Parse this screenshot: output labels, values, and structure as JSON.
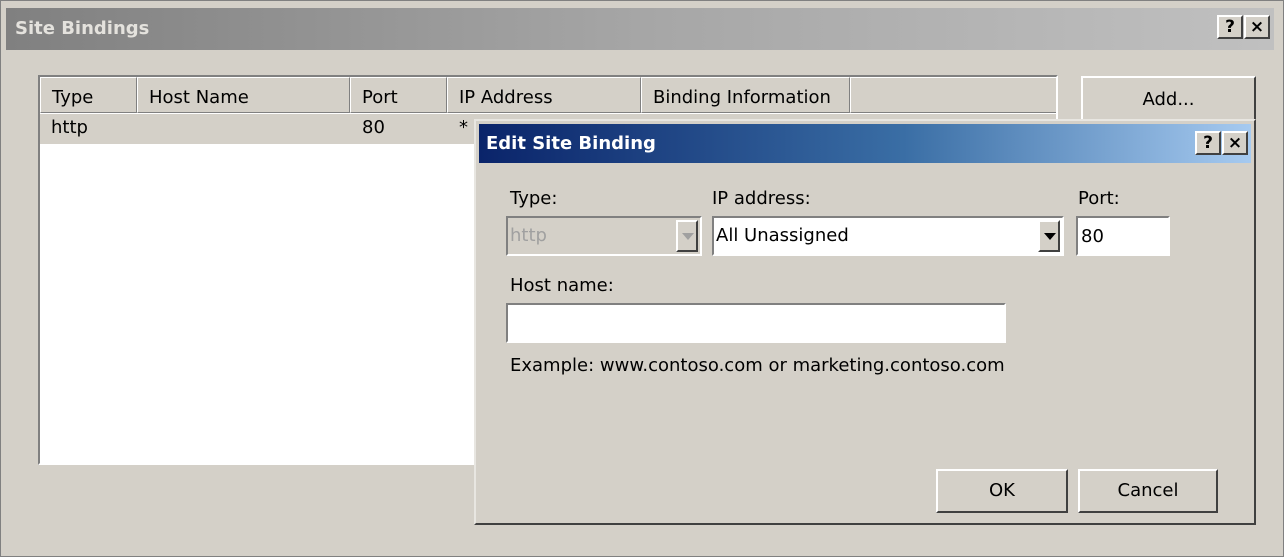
{
  "outer_dialog": {
    "title": "Site Bindings",
    "help_button": "?",
    "close_button": "×",
    "columns": [
      "Type",
      "Host Name",
      "Port",
      "IP Address",
      "Binding Information",
      ""
    ],
    "rows": [
      {
        "type": "http",
        "host_name": "",
        "port": "80",
        "ip_address": "*",
        "binding_information": ""
      }
    ],
    "add_button": "Add..."
  },
  "inner_dialog": {
    "title": "Edit Site Binding",
    "help_button": "?",
    "close_button": "×",
    "type_label": "Type:",
    "type_value": "http",
    "ip_label": "IP address:",
    "ip_value": "All Unassigned",
    "port_label": "Port:",
    "port_value": "80",
    "host_label": "Host name:",
    "host_value": "",
    "example_text": "Example: www.contoso.com or marketing.contoso.com",
    "ok_button": "OK",
    "cancel_button": "Cancel"
  }
}
